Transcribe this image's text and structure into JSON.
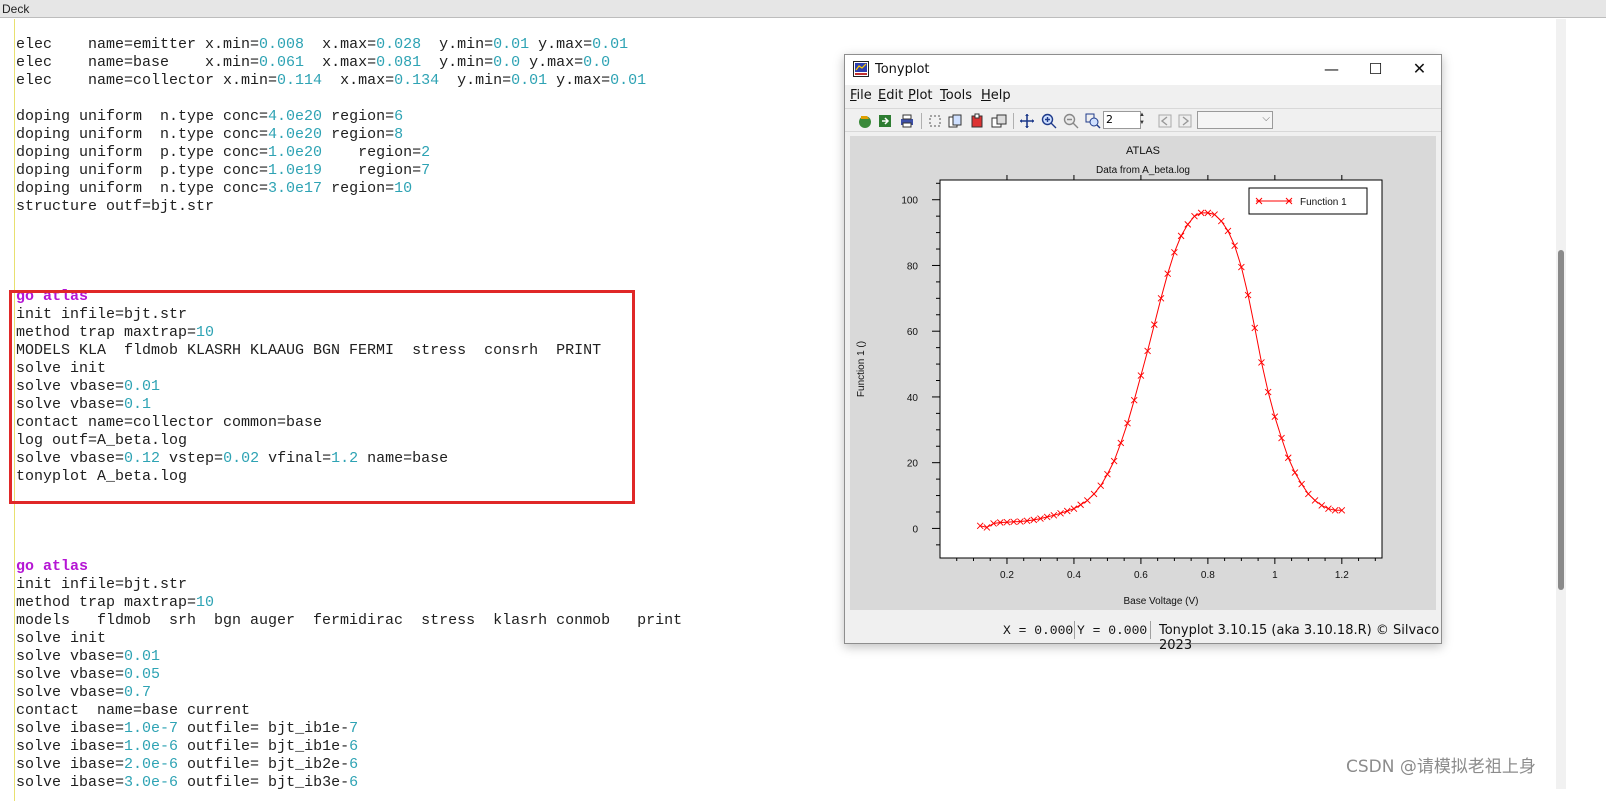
{
  "deck": {
    "title": "Deck",
    "code_lines": [
      [
        [
          "elec    name=emitter x.min=",
          ""
        ],
        [
          "0.008",
          "num"
        ],
        [
          "  x.max=",
          ""
        ],
        [
          "0.028",
          "num"
        ],
        [
          "  y.min=",
          ""
        ],
        [
          "0.01",
          "num"
        ],
        [
          " y.max=",
          ""
        ],
        [
          "0.01",
          "num"
        ]
      ],
      [
        [
          "elec    name=base    x.min=",
          ""
        ],
        [
          "0.061",
          "num"
        ],
        [
          "  x.max=",
          ""
        ],
        [
          "0.081",
          "num"
        ],
        [
          "  y.min=",
          ""
        ],
        [
          "0.0",
          "num"
        ],
        [
          " y.max=",
          ""
        ],
        [
          "0.0",
          "num"
        ]
      ],
      [
        [
          "elec    name=collector x.min=",
          ""
        ],
        [
          "0.114",
          "num"
        ],
        [
          "  x.max=",
          ""
        ],
        [
          "0.134",
          "num"
        ],
        [
          "  y.min=",
          ""
        ],
        [
          "0.01",
          "num"
        ],
        [
          " y.max=",
          ""
        ],
        [
          "0.01",
          "num"
        ]
      ],
      [],
      [
        [
          "doping uniform  n.type conc=",
          ""
        ],
        [
          "4.0e20",
          "num"
        ],
        [
          " region=",
          ""
        ],
        [
          "6",
          "num"
        ]
      ],
      [
        [
          "doping uniform  n.type conc=",
          ""
        ],
        [
          "4.0e20",
          "num"
        ],
        [
          " region=",
          ""
        ],
        [
          "8",
          "num"
        ]
      ],
      [
        [
          "doping uniform  p.type conc=",
          ""
        ],
        [
          "1.0e20",
          "num"
        ],
        [
          "    region=",
          ""
        ],
        [
          "2",
          "num"
        ]
      ],
      [
        [
          "doping uniform  p.type conc=",
          ""
        ],
        [
          "1.0e19",
          "num"
        ],
        [
          "    region=",
          ""
        ],
        [
          "7",
          "num"
        ]
      ],
      [
        [
          "doping uniform  n.type conc=",
          ""
        ],
        [
          "3.0e17",
          "num"
        ],
        [
          " region=",
          ""
        ],
        [
          "10",
          "num"
        ]
      ],
      [
        [
          "structure outf=bjt.str",
          ""
        ]
      ],
      [],
      [],
      [],
      [],
      [
        [
          "go atlas",
          "kw"
        ]
      ],
      [
        [
          "init infile=bjt.str",
          ""
        ]
      ],
      [
        [
          "method trap maxtrap=",
          ""
        ],
        [
          "10",
          "num"
        ]
      ],
      [
        [
          "MODELS KLA  fldmob KLASRH KLAAUG BGN FERMI  stress  consrh  PRINT",
          ""
        ]
      ],
      [
        [
          "solve init",
          ""
        ]
      ],
      [
        [
          "solve vbase=",
          ""
        ],
        [
          "0.01",
          "num"
        ]
      ],
      [
        [
          "solve vbase=",
          ""
        ],
        [
          "0.1",
          "num"
        ]
      ],
      [
        [
          "contact name=collector common=base",
          ""
        ]
      ],
      [
        [
          "log outf=A_beta.log",
          ""
        ]
      ],
      [
        [
          "solve vbase=",
          ""
        ],
        [
          "0.12",
          "num"
        ],
        [
          " vstep=",
          ""
        ],
        [
          "0.02",
          "num"
        ],
        [
          " vfinal=",
          ""
        ],
        [
          "1.2",
          "num"
        ],
        [
          " name=base",
          ""
        ]
      ],
      [
        [
          "tonyplot A_beta.log",
          ""
        ]
      ],
      [],
      [],
      [],
      [],
      [
        [
          "go atlas",
          "kw"
        ]
      ],
      [
        [
          "init infile=bjt.str",
          ""
        ]
      ],
      [
        [
          "method trap maxtrap=",
          ""
        ],
        [
          "10",
          "num"
        ]
      ],
      [
        [
          "models   fldmob  srh  bgn auger  fermidirac  stress  klasrh conmob   print",
          ""
        ]
      ],
      [
        [
          "solve init",
          ""
        ]
      ],
      [
        [
          "solve vbase=",
          ""
        ],
        [
          "0.01",
          "num"
        ]
      ],
      [
        [
          "solve vbase=",
          ""
        ],
        [
          "0.05",
          "num"
        ]
      ],
      [
        [
          "solve vbase=",
          ""
        ],
        [
          "0.7",
          "num"
        ]
      ],
      [
        [
          "contact  name=base current",
          ""
        ]
      ],
      [
        [
          "solve ibase=",
          ""
        ],
        [
          "1.0e-7",
          "num"
        ],
        [
          " outfile= bjt_ib1e-",
          ""
        ],
        [
          "7",
          "num"
        ]
      ],
      [
        [
          "solve ibase=",
          ""
        ],
        [
          "1.0e-6",
          "num"
        ],
        [
          " outfile= bjt_ib1e-",
          ""
        ],
        [
          "6",
          "num"
        ]
      ],
      [
        [
          "solve ibase=",
          ""
        ],
        [
          "2.0e-6",
          "num"
        ],
        [
          " outfile= bjt_ib2e-",
          ""
        ],
        [
          "6",
          "num"
        ]
      ],
      [
        [
          "solve ibase=",
          ""
        ],
        [
          "3.0e-6",
          "num"
        ],
        [
          " outfile= bjt_ib3e-",
          ""
        ],
        [
          "6",
          "num"
        ]
      ]
    ],
    "watermark": "CSDN @请模拟老祖上身"
  },
  "tonyplot": {
    "title": "Tonyplot",
    "window_buttons": {
      "minimize": "—",
      "maximize": "☐",
      "close": "✕"
    },
    "menus": [
      {
        "accel": "F",
        "rest": "ile"
      },
      {
        "accel": "E",
        "rest": "dit"
      },
      {
        "accel": "P",
        "rest": "lot"
      },
      {
        "accel": "T",
        "rest": "ools"
      },
      {
        "accel": "H",
        "rest": "elp"
      }
    ],
    "zoom_value": "2",
    "status": {
      "x_readout": "X = 0.000",
      "y_readout": "Y = 0.000",
      "version": "Tonyplot 3.10.15 (aka 3.10.18.R) © Silvaco 2023"
    },
    "colors": {
      "series": "#ff0000",
      "plot_bg": "#d9d9d9"
    }
  },
  "chart_data": {
    "type": "line",
    "title": "ATLAS",
    "subtitle": "Data from A_beta.log",
    "xlabel": "Base Voltage (V)",
    "ylabel": "Function 1 ()",
    "xlim": [
      0.0,
      1.32
    ],
    "ylim": [
      -9,
      106
    ],
    "x_ticks": [
      "0.2",
      "0.4",
      "0.6",
      "0.8",
      "1",
      "1.2"
    ],
    "x_tick_values": [
      0.2,
      0.4,
      0.6,
      0.8,
      1.0,
      1.2
    ],
    "y_ticks": [
      "0",
      "20",
      "40",
      "60",
      "80",
      "100"
    ],
    "y_tick_values": [
      0,
      20,
      40,
      60,
      80,
      100
    ],
    "legend": "top-right",
    "grid": false,
    "series": [
      {
        "name": "Function 1",
        "marker": "x",
        "x": [
          0.12,
          0.14,
          0.16,
          0.18,
          0.2,
          0.22,
          0.24,
          0.26,
          0.28,
          0.3,
          0.32,
          0.34,
          0.36,
          0.38,
          0.4,
          0.42,
          0.44,
          0.46,
          0.48,
          0.5,
          0.52,
          0.54,
          0.56,
          0.58,
          0.6,
          0.62,
          0.64,
          0.66,
          0.68,
          0.7,
          0.72,
          0.74,
          0.76,
          0.78,
          0.8,
          0.82,
          0.84,
          0.86,
          0.88,
          0.9,
          0.92,
          0.94,
          0.96,
          0.98,
          1.0,
          1.02,
          1.04,
          1.06,
          1.08,
          1.1,
          1.12,
          1.14,
          1.16,
          1.18,
          1.2
        ],
        "y": [
          0.8,
          0.3,
          1.5,
          1.8,
          1.9,
          2.0,
          2.1,
          2.3,
          2.6,
          3.0,
          3.5,
          4.0,
          4.6,
          5.3,
          6.0,
          7.2,
          8.5,
          10.5,
          13.0,
          16.5,
          20.5,
          26.0,
          32.0,
          39.0,
          46.5,
          54.0,
          62.0,
          70.0,
          77.5,
          84.0,
          89.0,
          92.5,
          95.0,
          96.0,
          96.0,
          95.5,
          93.5,
          90.5,
          86.0,
          79.5,
          71.0,
          61.0,
          50.5,
          41.5,
          34.0,
          27.5,
          21.5,
          17.0,
          13.5,
          10.5,
          8.5,
          7.0,
          6.0,
          5.5,
          5.5
        ]
      }
    ]
  }
}
